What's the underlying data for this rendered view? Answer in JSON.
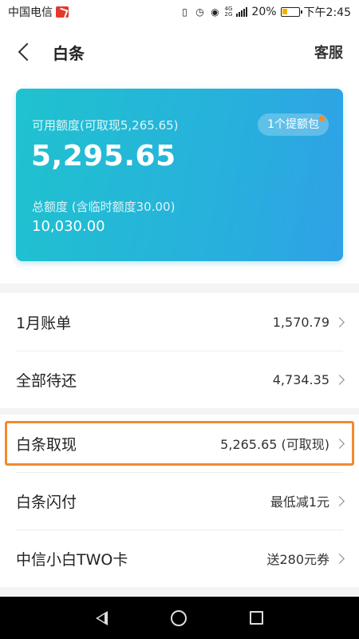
{
  "status_bar": {
    "carrier": "中国电信",
    "battery": "20%",
    "time": "下午2:45",
    "network_top": "4G",
    "network_bottom": "2G"
  },
  "header": {
    "title": "白条",
    "service": "客服"
  },
  "card": {
    "available_label": "可用额度(可取现5,265.65)",
    "available_amount": "5,295.65",
    "pack_badge": "1个提额包",
    "total_label": "总额度 (含临时额度30.00)",
    "total_amount": "10,030.00",
    "colors": {
      "start": "#1fc2cf",
      "end": "#2fa1e6",
      "badge_dot": "#ff8a1f"
    }
  },
  "list1": [
    {
      "label": "1月账单",
      "value": "1,570.79"
    },
    {
      "label": "全部待还",
      "value": "4,734.35"
    }
  ],
  "list2": [
    {
      "label": "白条取现",
      "value": "5,265.65 (可取现)"
    },
    {
      "label": "白条闪付",
      "value": "最低减1元"
    },
    {
      "label": "中信小白TWO卡",
      "value": "送280元券"
    }
  ],
  "highlight_color": "#f28a2e",
  "icons": [
    "back-icon",
    "chevron-right-icon",
    "nav-back-icon",
    "nav-home-icon",
    "nav-recent-icon"
  ]
}
